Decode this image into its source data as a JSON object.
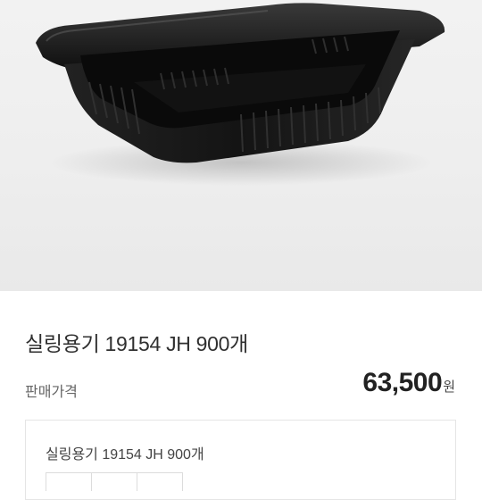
{
  "product": {
    "name": "실링용기 19154 JH 900개",
    "price_label": "판매가격",
    "price_amount": "63,500",
    "price_unit": "원"
  },
  "option": {
    "name": "실링용기 19154 JH 900개"
  },
  "colors": {
    "container": "#1a1a1a",
    "background": "#eeeeee"
  }
}
